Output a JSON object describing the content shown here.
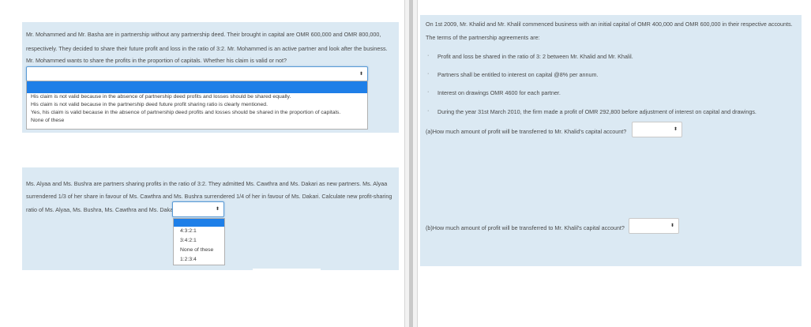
{
  "q1": {
    "line1": "Mr. Mohammed and Mr. Basha are in partnership without any partnership deed. Their brought in capital are OMR 600,000 and OMR 800,000,",
    "line2": "respectively. They decided to share their future profit and loss in the ratio of 3:2. Mr. Mohammed is an active partner and look after the business.",
    "line3": "Mr. Mohammed wants to share the  profits in the proportion of capitals. Whether his claim is valid or not?",
    "selected": "",
    "options": [
      "His claim is not valid because in the absence of partnership deed profits and losses should be shared equally.",
      "His claim is not valid because in the partnership deed future profit sharing ratio is clearly mentioned.",
      "Yes, his claim is valid because in the absence of partnership deed profits and losses should be shared in the proportion of capitals.",
      "None of these"
    ]
  },
  "q2": {
    "line1": "Ms. Alyaa and Ms. Bushra are partners sharing profits in the ratio of 3:2. They admitted Ms. Cawthra and Ms. Dakari as new partners.  Ms. Alyaa",
    "line2": "surrendered 1/3 of her share in favour of   Ms. Cawthra and Ms. Bushra surrendered 1/4 of her in favour of Ms. Dakari. Calculate new profit-sharing",
    "line3": "ratio of Ms. Alyaa, Ms. Bushra, Ms. Cawthra and Ms. Dakari.",
    "selected": "",
    "options": [
      "4:3:2:1",
      "3:4:2:1",
      "None of these",
      "1:2:3:4"
    ]
  },
  "q3": {
    "intro": "On 1st 2009, Mr. Khalid and Mr. Khalil commenced business with an initial capital of OMR 400,000 and OMR 600,000 in their respective accounts.",
    "terms_heading": "The terms of the partnership agreements are:",
    "bullets": [
      "Profit and loss be shared in the ratio of 3: 2 between Mr. Khalid and Mr. Khalil.",
      "Partners shall be entitled to interest on capital @8% per annum.",
      "Interest on drawings OMR 4600 for each partner.",
      "During the year 31st March 2010, the firm made a profit of OMR 292,800 before adjustment of interest on capital and drawings."
    ],
    "bullet_mark": "·",
    "part_a": "(a)How much amount of profit will be transferred to Mr. Khalid's capital account?",
    "part_b": "(b)How much amount of profit will be transferred to Mr. Khalil's capital account?",
    "selected_a": "",
    "selected_b": ""
  },
  "icons": {
    "select_arrow": "⬍"
  },
  "colors": {
    "card_bg": "#dbe9f3",
    "focus_border": "#5b9bd5",
    "highlight": "#1e7fe8"
  }
}
